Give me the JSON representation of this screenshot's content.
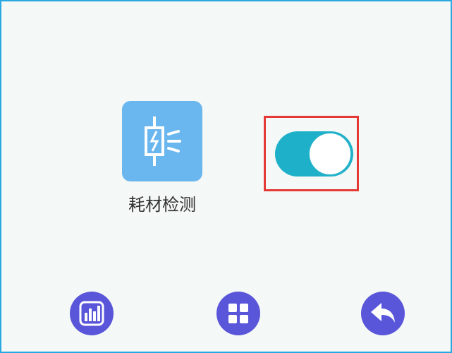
{
  "feature": {
    "label": "耗材检测",
    "icon": "consumable-detection-icon"
  },
  "toggle": {
    "state": "on",
    "highlighted": true
  },
  "nav": {
    "items": [
      {
        "icon": "bar-chart-icon"
      },
      {
        "icon": "grid-menu-icon"
      },
      {
        "icon": "back-arrow-icon"
      }
    ]
  },
  "colors": {
    "border": "#29a9e1",
    "background": "#f4f8f6",
    "tile": "#6ab6ee",
    "toggle_on": "#1fb0c9",
    "highlight": "#e53935",
    "nav_button": "#5a56d9"
  }
}
